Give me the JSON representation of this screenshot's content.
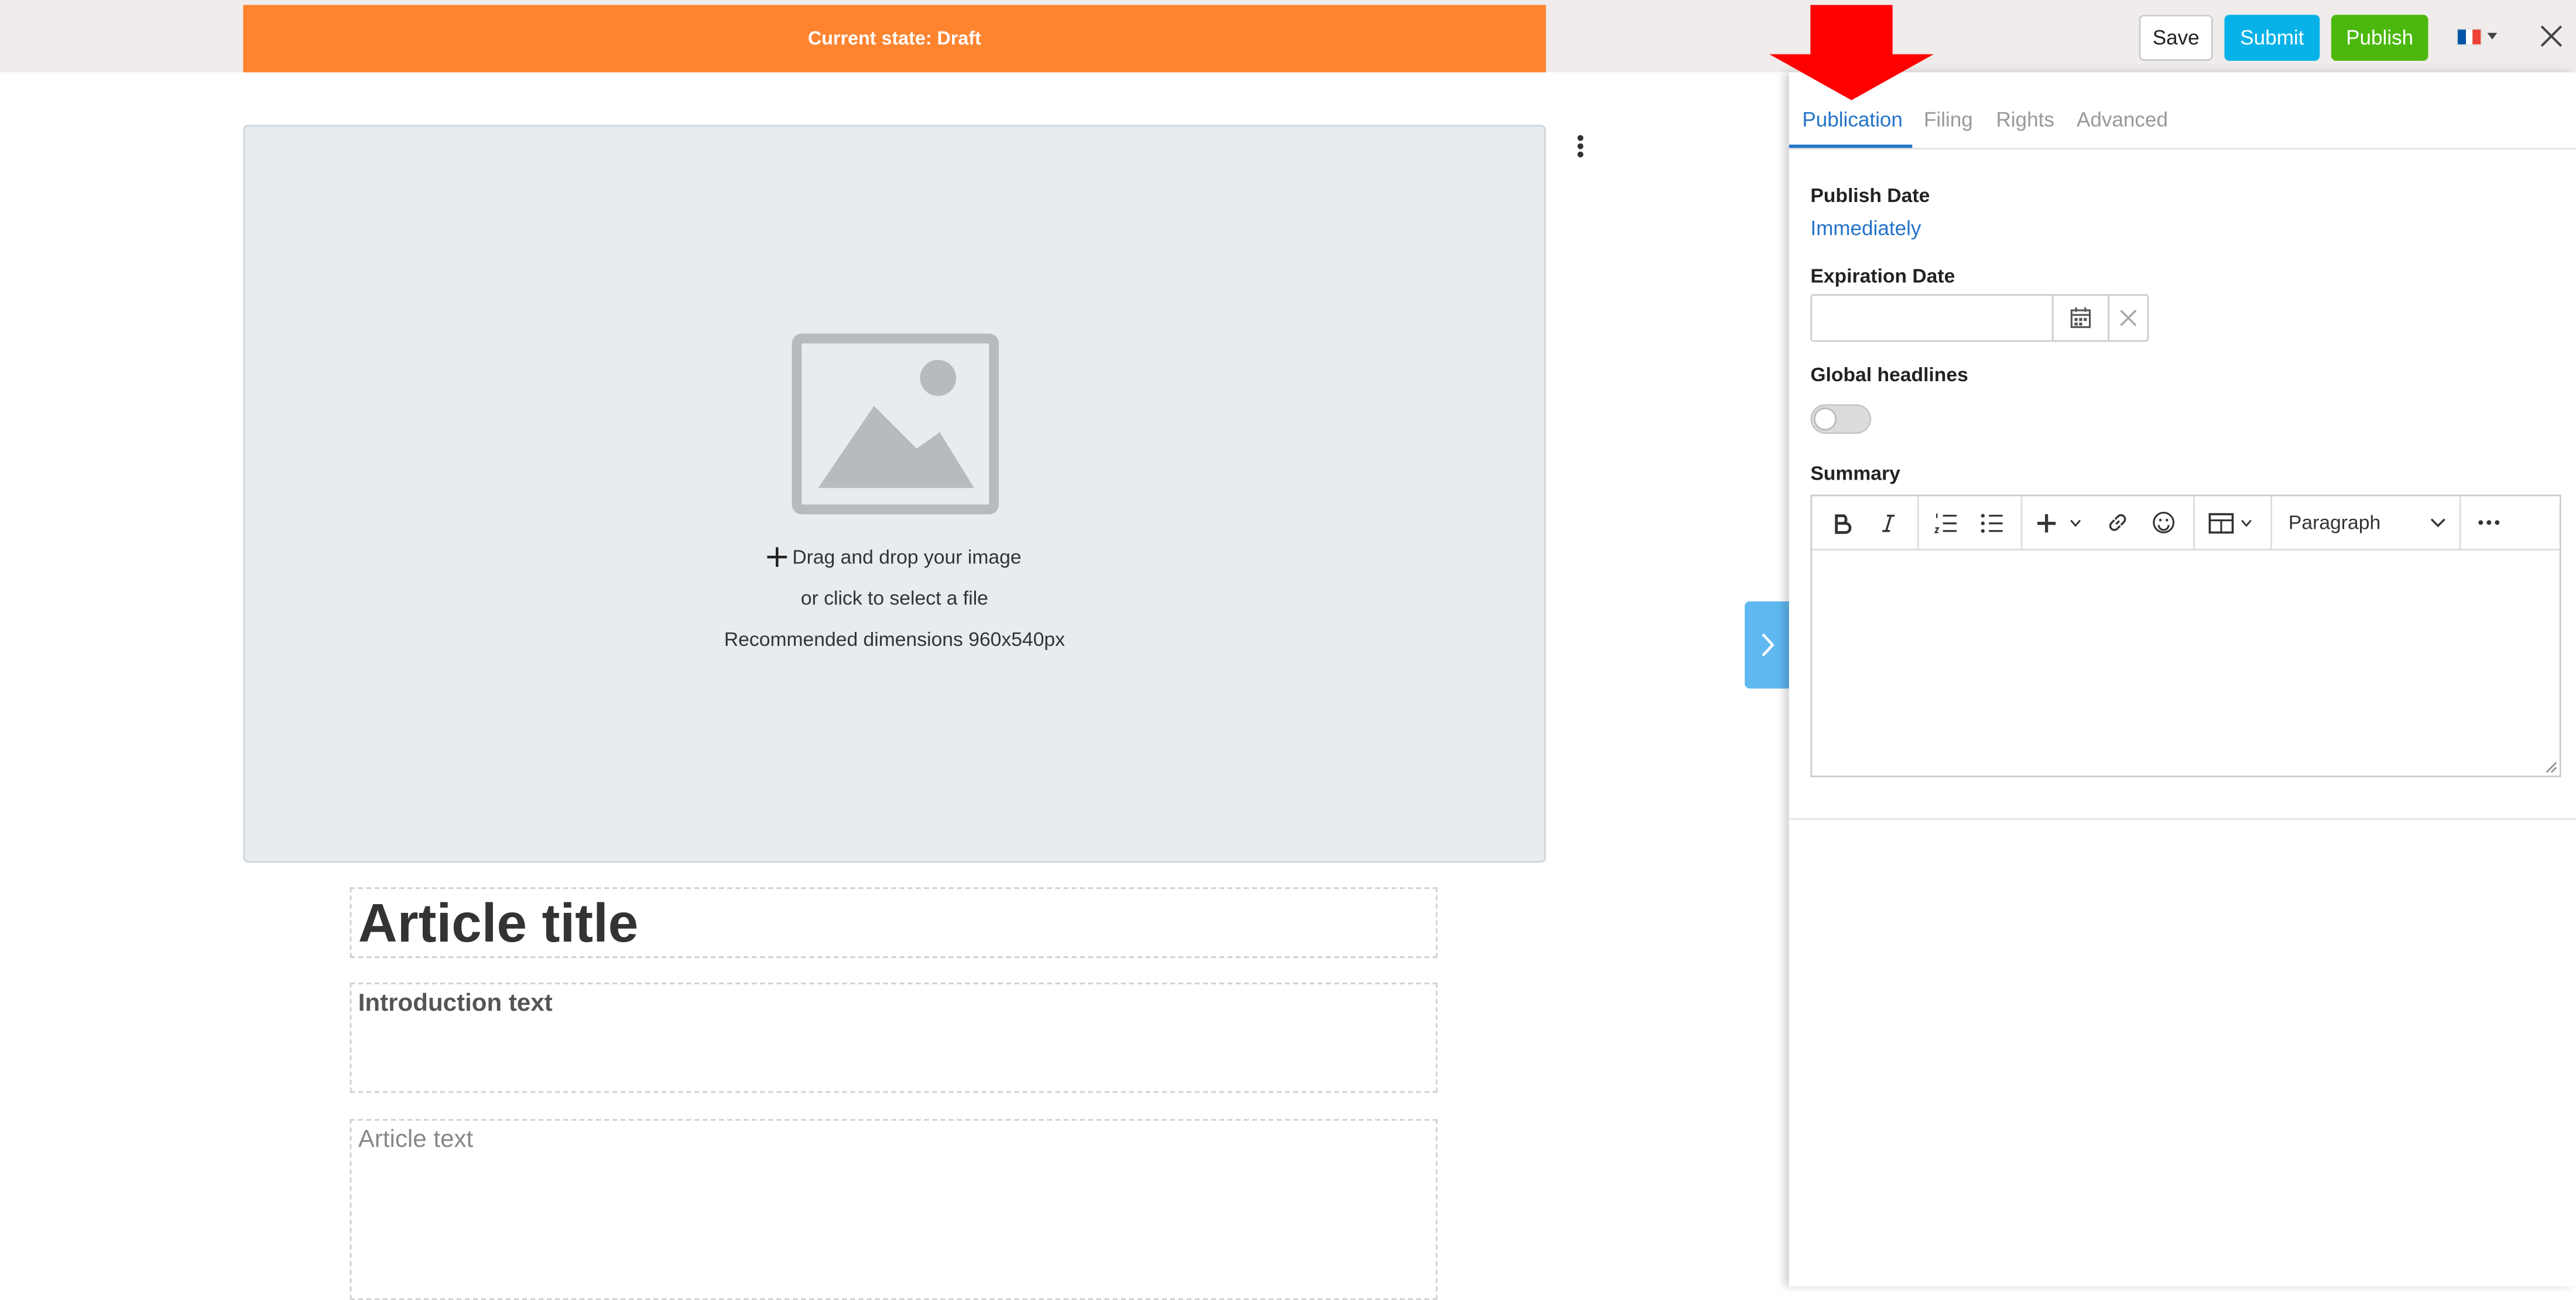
{
  "topbar": {
    "state_label": "Current state: Draft",
    "save_label": "Save",
    "submit_label": "Submit",
    "publish_label": "Publish",
    "language": {
      "icon": "flag-fr-icon",
      "colors": [
        "#0055a4",
        "#ffffff",
        "#ef4135"
      ]
    }
  },
  "colors": {
    "state_banner": "#fe8430",
    "submit": "#06b2e8",
    "publish": "#4cb80e",
    "accent": "#2473c9",
    "annotation_arrow": "#ff0000"
  },
  "editor": {
    "dropzone": {
      "line1": "Drag and drop your image",
      "line2": "or click to select a file",
      "line3": "Recommended dimensions 960x540px"
    },
    "title_placeholder": "Article title",
    "intro_placeholder": "Introduction text",
    "body_placeholder": "Article text"
  },
  "panel": {
    "tabs": [
      {
        "label": "Publication",
        "active": true
      },
      {
        "label": "Filing",
        "active": false
      },
      {
        "label": "Rights",
        "active": false
      },
      {
        "label": "Advanced",
        "active": false
      }
    ],
    "publish_date_label": "Publish Date",
    "publish_date_value": "Immediately",
    "expiration_date_label": "Expiration Date",
    "expiration_date_value": "",
    "global_headlines_label": "Global headlines",
    "global_headlines_on": false,
    "summary_label": "Summary",
    "summary_toolbar": {
      "items": [
        "bold-icon",
        "italic-icon",
        "numbered-list-icon",
        "bullet-list-icon",
        "insert-icon",
        "link-icon",
        "emoji-icon",
        "table-icon",
        "more-icon"
      ],
      "block_format": "Paragraph"
    },
    "summary_value": ""
  }
}
